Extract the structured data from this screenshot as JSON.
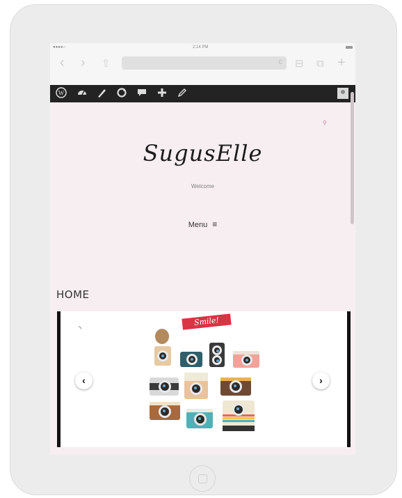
{
  "statusbar": {
    "carrier": "●●●●○",
    "time": "2:14 PM"
  },
  "browser": {
    "back": "‹",
    "forward": "›",
    "share": "⇧",
    "reload": "c",
    "bookmarks": "⊟",
    "tabs": "⧉",
    "new_tab": "+"
  },
  "adminbar": {
    "icons": [
      "wordpress-icon",
      "dashboard-icon",
      "customize-icon",
      "updates-icon",
      "comments-icon",
      "new-icon",
      "edit-icon"
    ]
  },
  "site": {
    "logo": "SugusElle",
    "tagline": "Welcome",
    "menu_label": "Menu",
    "menu_icon": "≡",
    "search_icon": "⚲",
    "page_title": "HOME"
  },
  "slider": {
    "banner_text": "Smile!",
    "prev": "‹",
    "next": "›",
    "colors": {
      "accent": "#d93344",
      "background": "#f7eef1",
      "adminbar": "#232323"
    }
  }
}
